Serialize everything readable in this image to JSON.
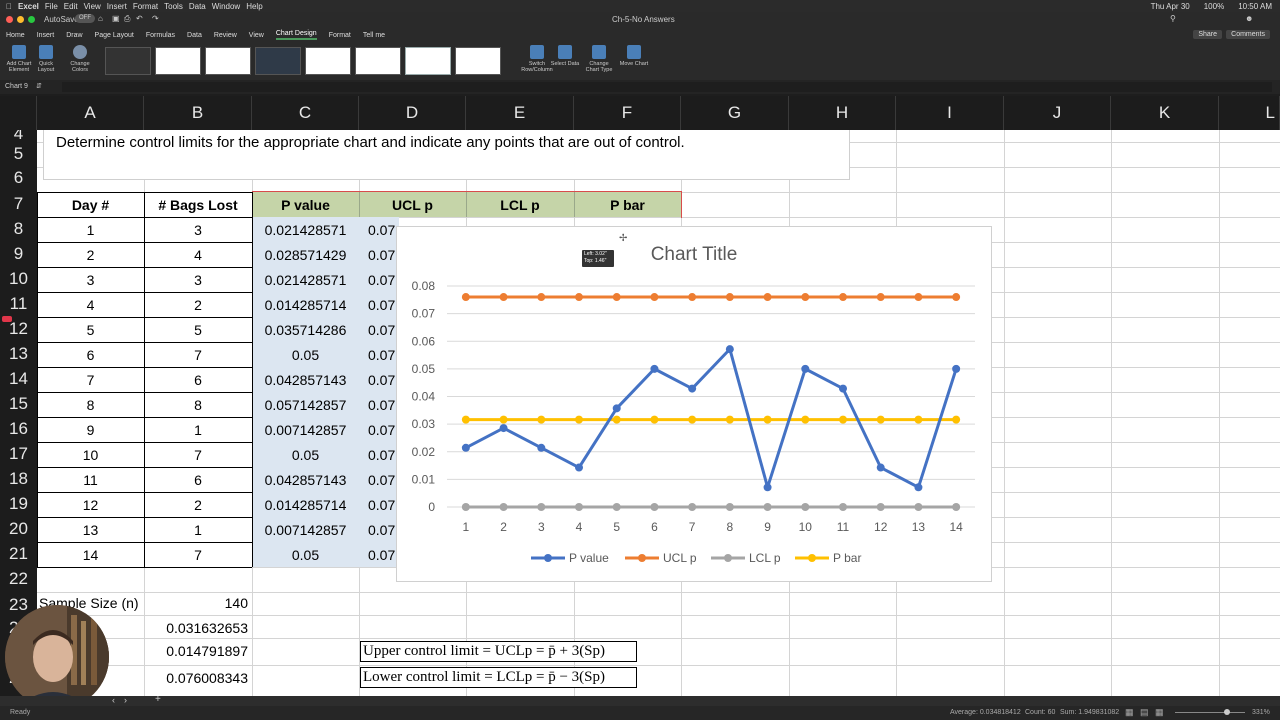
{
  "menubar": {
    "items": [
      "Excel",
      "File",
      "Edit",
      "View",
      "Insert",
      "Format",
      "Tools",
      "Data",
      "Window",
      "Help"
    ],
    "right": [
      "Thu Apr 30",
      "100%",
      "10:50 AM"
    ]
  },
  "titlebar": {
    "autosave": "AutoSave",
    "autosave_state": "OFF",
    "title": "Ch-5-No Answers"
  },
  "ribbon": {
    "tabs": [
      "Home",
      "Insert",
      "Draw",
      "Page Layout",
      "Formulas",
      "Data",
      "Review",
      "View",
      "Chart Design",
      "Format",
      "Tell me"
    ],
    "active_tab": "Chart Design",
    "share": "Share",
    "comments": "Comments",
    "buttons": {
      "add_chart_element": "Add Chart Element",
      "quick_layout": "Quick Layout",
      "change_colors": "Change Colors",
      "switch_row_col": "Switch Row/Column",
      "select_data": "Select Data",
      "change_chart_type": "Change Chart Type",
      "move_chart": "Move Chart"
    }
  },
  "formula_bar": {
    "name_box": "Chart 9"
  },
  "columns": [
    "A",
    "B",
    "C",
    "D",
    "E",
    "F",
    "G",
    "H",
    "I",
    "J",
    "K",
    "L"
  ],
  "rows": [
    "4",
    "5",
    "6",
    "7",
    "8",
    "9",
    "10",
    "11",
    "12",
    "13",
    "14",
    "15",
    "16",
    "17",
    "18",
    "19",
    "20",
    "21",
    "22",
    "23",
    "24",
    "25",
    "26"
  ],
  "instruction": "Determine control limits for the appropriate chart and indicate any points that are out of control.",
  "table": {
    "headers": [
      "Day #",
      "# Bags Lost",
      "P value",
      "UCL p",
      "LCL p",
      "P bar"
    ],
    "days": [
      "1",
      "2",
      "3",
      "4",
      "5",
      "6",
      "7",
      "8",
      "9",
      "10",
      "11",
      "12",
      "13",
      "14"
    ],
    "bags": [
      "3",
      "4",
      "3",
      "2",
      "5",
      "7",
      "6",
      "8",
      "1",
      "7",
      "6",
      "2",
      "1",
      "7"
    ],
    "p_values": [
      "0.021428571",
      "0.028571429",
      "0.021428571",
      "0.014285714",
      "0.035714286",
      "0.05",
      "0.042857143",
      "0.057142857",
      "0.007142857",
      "0.05",
      "0.042857143",
      "0.014285714",
      "0.007142857",
      "0.05"
    ],
    "ucl_partial": "0.07"
  },
  "summary": {
    "sample_size_label": "Sample Size (n)",
    "sample_size": "140",
    "pbar": "0.031632653",
    "sp": "0.014791897",
    "ucl": "0.076008343"
  },
  "formulas": {
    "ucl": "Upper control limit = UCLp = p̄ + 3(Sp)",
    "lcl": "Lower control limit = LCLp = p̄ − 3(Sp)"
  },
  "chart_tooltip": {
    "left": "Left: 3.02\"",
    "top": "Top: 1.46\""
  },
  "chart_data": {
    "type": "line",
    "title": "Chart Title",
    "x": [
      1,
      2,
      3,
      4,
      5,
      6,
      7,
      8,
      9,
      10,
      11,
      12,
      13,
      14
    ],
    "ylim": [
      0,
      0.08
    ],
    "yticks": [
      "0",
      "0.01",
      "0.02",
      "0.03",
      "0.04",
      "0.05",
      "0.06",
      "0.07",
      "0.08"
    ],
    "grid": true,
    "legend": "bottom",
    "series": [
      {
        "name": "P value",
        "color": "#4472c4",
        "values": [
          0.021428571,
          0.028571429,
          0.021428571,
          0.014285714,
          0.035714286,
          0.05,
          0.042857143,
          0.057142857,
          0.007142857,
          0.05,
          0.042857143,
          0.014285714,
          0.007142857,
          0.05
        ]
      },
      {
        "name": "UCL p",
        "color": "#ed7d31",
        "values": [
          0.076008343,
          0.076008343,
          0.076008343,
          0.076008343,
          0.076008343,
          0.076008343,
          0.076008343,
          0.076008343,
          0.076008343,
          0.076008343,
          0.076008343,
          0.076008343,
          0.076008343,
          0.076008343
        ]
      },
      {
        "name": "LCL p",
        "color": "#a5a5a5",
        "values": [
          0,
          0,
          0,
          0,
          0,
          0,
          0,
          0,
          0,
          0,
          0,
          0,
          0,
          0
        ]
      },
      {
        "name": "P bar",
        "color": "#ffc000",
        "values": [
          0.031632653,
          0.031632653,
          0.031632653,
          0.031632653,
          0.031632653,
          0.031632653,
          0.031632653,
          0.031632653,
          0.031632653,
          0.031632653,
          0.031632653,
          0.031632653,
          0.031632653,
          0.031632653
        ]
      }
    ]
  },
  "status": {
    "ready": "Ready",
    "average": "Average: 0.034818412",
    "count": "Count: 60",
    "sum": "Sum: 1.949831082",
    "zoom": "331%"
  }
}
